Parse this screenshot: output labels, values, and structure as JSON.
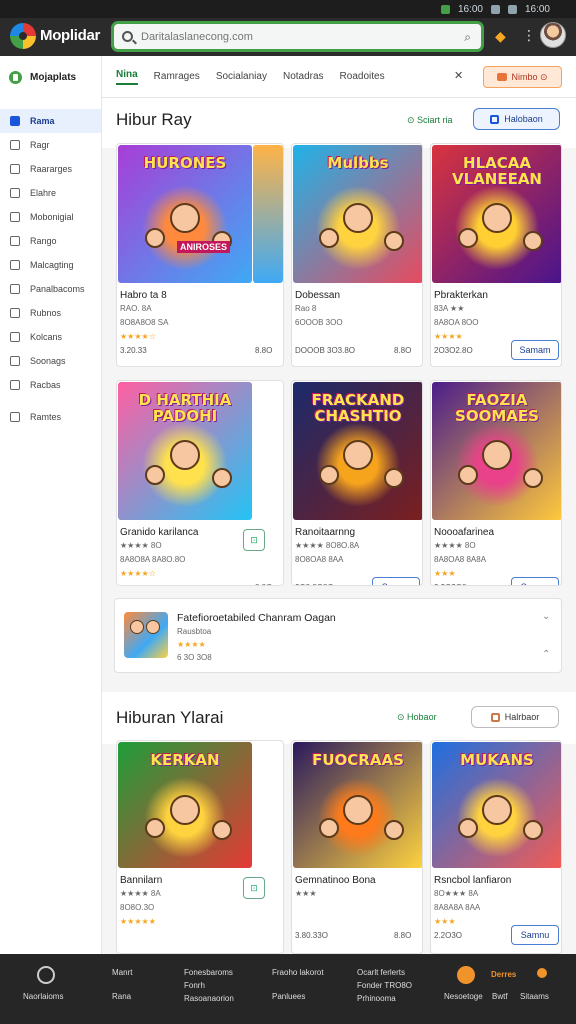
{
  "status": {
    "icons": [
      "wifi-icon",
      "signal-icon",
      "battery-icon"
    ],
    "time": "16:00",
    "time2": "16:00"
  },
  "app": {
    "name": "Moplidar",
    "search_placeholder": "Daritalaslanecong.com"
  },
  "sidebar": {
    "brand": "Mojaplats",
    "items": [
      {
        "label": "Rama",
        "icon": "home-icon"
      },
      {
        "label": "Ragr",
        "icon": "page-icon"
      },
      {
        "label": "Raararges",
        "icon": "bell-icon"
      },
      {
        "label": "Elahre",
        "icon": "clock-icon"
      },
      {
        "label": "Mobonigial",
        "icon": "star-icon"
      },
      {
        "label": "Rango",
        "icon": "grid-icon"
      },
      {
        "label": "Malcagting",
        "icon": "list-icon"
      },
      {
        "label": "Panalbacoms",
        "icon": "folder-icon"
      },
      {
        "label": "Rubnos",
        "icon": "chat-icon"
      },
      {
        "label": "Kolcans",
        "icon": "bookmark-icon"
      },
      {
        "label": "Soonags",
        "icon": "gear-icon"
      },
      {
        "label": "Racbas",
        "icon": "chart-icon"
      },
      {
        "label": "Ramtes",
        "icon": "shield-icon"
      }
    ]
  },
  "tabs": [
    {
      "label": "Nina",
      "active": true
    },
    {
      "label": "Ramrages"
    },
    {
      "label": "Socialaniay"
    },
    {
      "label": "Notadras"
    },
    {
      "label": "Roadoites"
    }
  ],
  "promo": {
    "label": "Nimbo ⊙"
  },
  "section1": {
    "title": "Hibur Ray",
    "link": "Sciart ria",
    "button": "Halobaon",
    "cards": [
      {
        "art": "HURONES",
        "art2": "ANIROSES",
        "title": "Habro ta 8",
        "meta": "RAO. 8A",
        "meta2": "8O8A8O8 SA",
        "price": "3.20.33",
        "stars": "★★★★☆",
        "extra": "8.8O",
        "palette": [
          "#a83ed6",
          "#ff8a3d",
          "#3fa9f5"
        ]
      },
      {
        "art": "Mulbbs",
        "title": "Dobessan",
        "meta": "Rao 8",
        "meta2": "6OOOB 3OO",
        "price": "DOOOB 3O3.8O",
        "stars": "",
        "extra": "8.8O",
        "palette": [
          "#1fb3e8",
          "#ffd23f",
          "#e84a5f"
        ]
      },
      {
        "art": "HLACAA VLANEEAN",
        "title": "Pbrakterkan",
        "meta": "83A ★★",
        "meta2": "8A8OA 8OO",
        "price": "2O3O2.8O",
        "stars": "★★★★",
        "extra": "",
        "button": "Samam",
        "palette": [
          "#d8343f",
          "#ffcf33",
          "#4a148c"
        ]
      }
    ]
  },
  "section2": {
    "cards": [
      {
        "art": "D HARTHIA PADOHI",
        "title": "Granido karilanca",
        "meta": "★★★★ 8O",
        "meta2": "8A8O8A 8A8O.8O",
        "price": "",
        "stars": "★★★★☆",
        "extra": "8.8O",
        "palette": [
          "#ff5fa2",
          "#ffe14d",
          "#23c4f5"
        ]
      },
      {
        "art": "FRACKAND CHASHTIO",
        "title": "Ranoitaarnng",
        "meta": "★★★★ 8O8O.8A",
        "meta2": "8O8OA8 8AA",
        "price": "2O8.8O8O",
        "stars": "",
        "extra": "",
        "button": "Samnu",
        "palette": [
          "#1b2a6b",
          "#f7a41d",
          "#7b1f1f"
        ]
      },
      {
        "art": "FAOZIA SOOMAES",
        "title": "Noooafarinea",
        "meta": "★★★★ 8O",
        "meta2": "8A8OA8 8A8A",
        "price": "2.2O3O8",
        "stars": "★★★",
        "extra": "",
        "button": "Samon",
        "palette": [
          "#4b1d8a",
          "#e9418a",
          "#ffc93c"
        ]
      }
    ]
  },
  "banner": {
    "title": "Fatefioroetabiled Chanram Oagan",
    "meta": "Rausbtoa",
    "stars": "★★★★",
    "meta2": "6 3O 3O8"
  },
  "section3": {
    "title": "Hiburan Ylarai",
    "link": "Hobaor",
    "button": "Halrbaor",
    "cards": [
      {
        "art": "KERKAN",
        "title": "Bannilarn",
        "meta": "★★★★ 8A",
        "meta2": "8O8O.3O",
        "price": "",
        "stars": "★★★★★",
        "extra": "",
        "palette": [
          "#1e9e3a",
          "#ffd23f",
          "#e53935"
        ]
      },
      {
        "art": "FUOCRAAS",
        "title": "Gemnatinoo Bona",
        "meta": "★★★",
        "meta2": "",
        "price": "3.80.33O",
        "stars": "",
        "extra": "8.8O",
        "palette": [
          "#2a1a5e",
          "#ff7a1a",
          "#ffd23f"
        ]
      },
      {
        "art": "MUKANS",
        "title": "Rsncbol lanfiaron",
        "meta": "8O★★★ 8A",
        "meta2": "8A8A8A 8AA",
        "price": "2.2O3O",
        "stars": "★★★",
        "extra": "",
        "button": "Samnu",
        "palette": [
          "#1e6fe0",
          "#ffd23f",
          "#f25c54"
        ]
      }
    ]
  },
  "footer": {
    "col1": "Naorlaioms",
    "col2": [
      "Manrt",
      "Rana"
    ],
    "col3": [
      "Fonesbaroms",
      "Fonrh",
      "Rasoanaorion"
    ],
    "col4": [
      "Fraoho lakorot",
      "Panluees"
    ],
    "col5": [
      "Ocarlt ferlerts",
      "Fonder TRO8O",
      "Prhinooma"
    ],
    "col6": [
      "Derres",
      "Nesoetoge",
      "Bwtf",
      "Sitaams"
    ]
  }
}
